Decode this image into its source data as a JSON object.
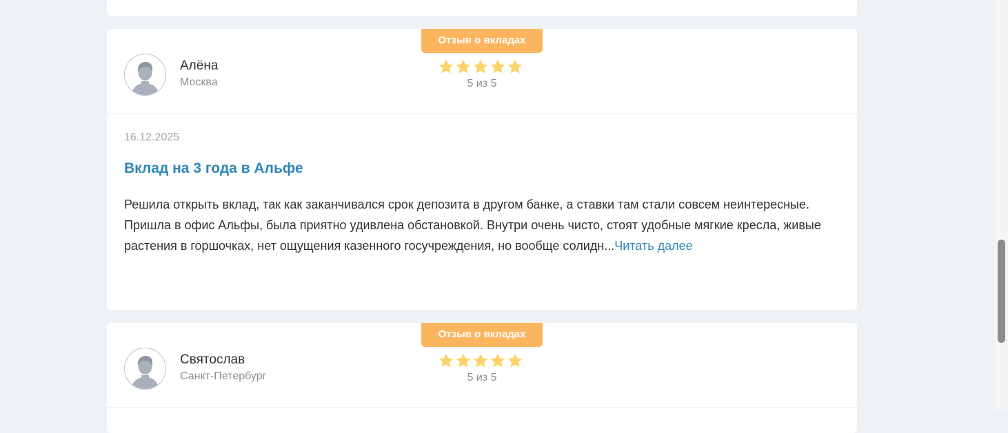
{
  "reviews": [
    {
      "badge": "Отзыв о вкладах",
      "author": "Алёна",
      "city": "Москва",
      "rating_value": 5,
      "rating_text": "5 из 5",
      "date": "16.12.2025",
      "title": "Вклад на 3 года в Альфе",
      "text": "Решила открыть вклад, так как заканчивался срок депозита в другом банке, а ставки там стали совсем неинтересные. Пришла в офис Альфы, была приятно удивлена обстановкой. Внутри очень чисто, стоят удобные мягкие кресла, живые растения в горшочках, нет ощущения казенного госучреждения, но вообще солидн...",
      "read_more": "Читать далее"
    },
    {
      "badge": "Отзыв о вкладах",
      "author": "Святослав",
      "city": "Санкт-Петербург",
      "rating_value": 5,
      "rating_text": "5 из 5"
    }
  ],
  "colors": {
    "accent": "#fbb55f",
    "link": "#2f87b6",
    "star": "#fcd36b",
    "background": "#eff2f5"
  },
  "icons": {
    "avatar": "user-avatar-icon",
    "star": "star-icon"
  }
}
